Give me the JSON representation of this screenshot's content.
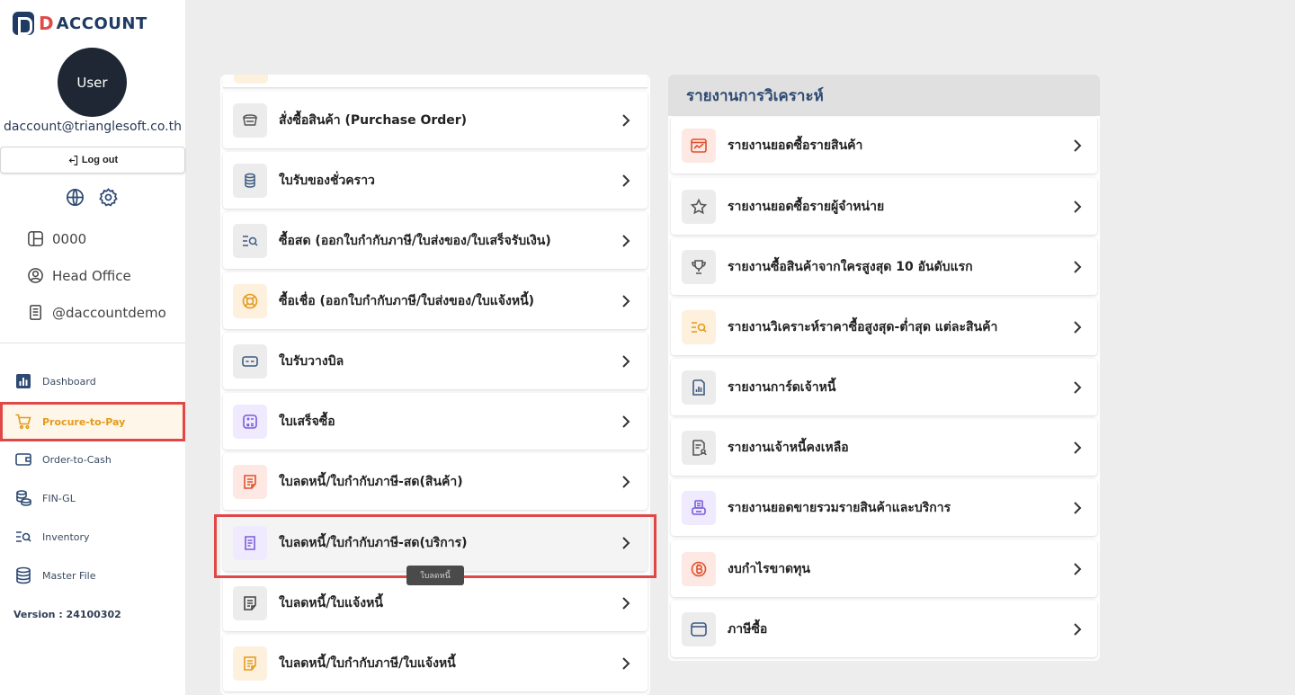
{
  "app": {
    "logo_d": "D",
    "logo_text": "ACCOUNT",
    "accent": "#e49a1c",
    "brand": "#1f3b64"
  },
  "user": {
    "avatar_label": "User",
    "email": "daccount@trianglesoft.co.th",
    "logout_label": "Log out"
  },
  "info": {
    "branch_code": "0000",
    "branch_name": "Head Office",
    "account": "@daccountdemo"
  },
  "nav": {
    "items": [
      {
        "label": "Dashboard",
        "icon": "chart-icon"
      },
      {
        "label": "Procure-to-Pay",
        "icon": "cart-icon",
        "active": true
      },
      {
        "label": "Order-to-Cash",
        "icon": "wallet-icon"
      },
      {
        "label": "FIN-GL",
        "icon": "coins-icon"
      },
      {
        "label": "Inventory",
        "icon": "list-search-icon"
      },
      {
        "label": "Master File",
        "icon": "database-icon"
      }
    ],
    "version": "Version : 24100302"
  },
  "menu": {
    "items": [
      {
        "label": "สั่งซื้อสินค้า (Purchase Order)"
      },
      {
        "label": "ใบรับของชั่วคราว"
      },
      {
        "label": "ซื้อสด (ออกใบกำกับภาษี/ใบส่งของ/ใบเสร็จรับเงิน)"
      },
      {
        "label": "ซื้อเชื่อ (ออกใบกำกับภาษี/ใบส่งของ/ใบแจ้งหนี้)"
      },
      {
        "label": "ใบรับวางบิล"
      },
      {
        "label": "ใบเสร็จซื้อ"
      },
      {
        "label": "ใบลดหนี้/ใบกำกับภาษี-สด(สินค้า)"
      },
      {
        "label": "ใบลดหนี้/ใบกำกับภาษี-สด(บริการ)"
      },
      {
        "label": "ใบลดหนี้/ใบแจ้งหนี้"
      },
      {
        "label": "ใบลดหนี้/ใบกำกับภาษี/ใบแจ้งหนี้"
      }
    ],
    "tooltip": "ใบลดหนี้"
  },
  "reports": {
    "title": "รายงานการวิเคราะห์",
    "items": [
      {
        "label": "รายงานยอดซื้อรายสินค้า"
      },
      {
        "label": "รายงานยอดซื้อรายผู้จำหน่าย"
      },
      {
        "label": "รายงานซื้อสินค้าจากใครสูงสุด 10 อันดับแรก"
      },
      {
        "label": "รายงานวิเคราะห์ราคาซื้อสูงสุด-ต่ำสุด แต่ละสินค้า"
      },
      {
        "label": "รายงานการ์ดเจ้าหนี้"
      },
      {
        "label": "รายงานเจ้าหนี้คงเหลือ"
      },
      {
        "label": "รายงานยอดขายรวมรายสินค้าและบริการ"
      },
      {
        "label": "งบกำไรขาดทุน"
      },
      {
        "label": "ภาษีซื้อ"
      }
    ]
  }
}
